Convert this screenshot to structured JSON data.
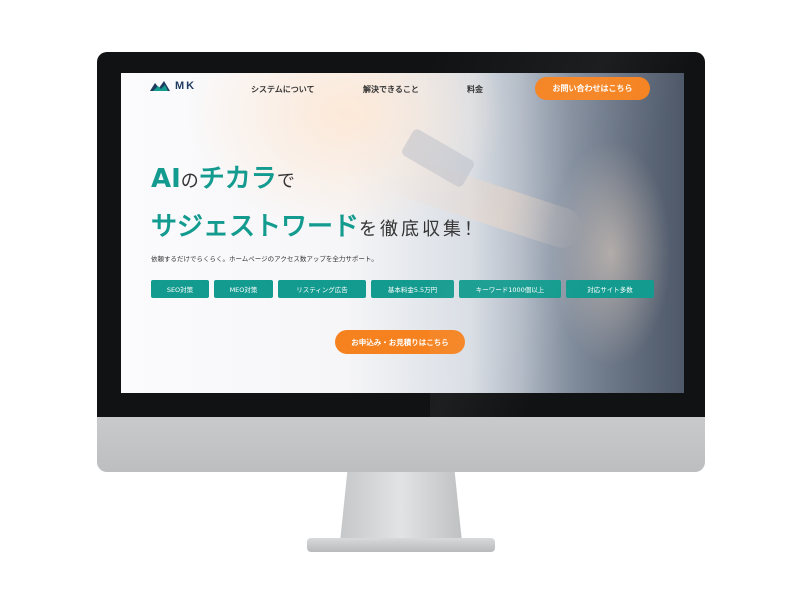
{
  "brand": {
    "logo_text": "MK"
  },
  "nav": {
    "items": [
      "システムについて",
      "解決できること",
      "料金"
    ],
    "contact_label": "お問い合わせはこちら"
  },
  "hero": {
    "line1_a": "AI",
    "line1_b": "の",
    "line1_c": "チカラ",
    "line1_d": "で",
    "line2_a": "サジェストワード",
    "line2_b": "を徹底収集！",
    "subtext": "依頼するだけでらくらく。ホームページのアクセス数アップを全力サポート。",
    "tags": [
      "SEO対策",
      "MEO対策",
      "リスティング広告",
      "基本料金5.5万円",
      "キーワード1000個以上",
      "対応サイト多数"
    ],
    "cta_label": "お申込み・お見積りはこちら"
  },
  "colors": {
    "accent": "#149b8f",
    "cta": "#f5821f",
    "logo": "#1f3a5f"
  }
}
